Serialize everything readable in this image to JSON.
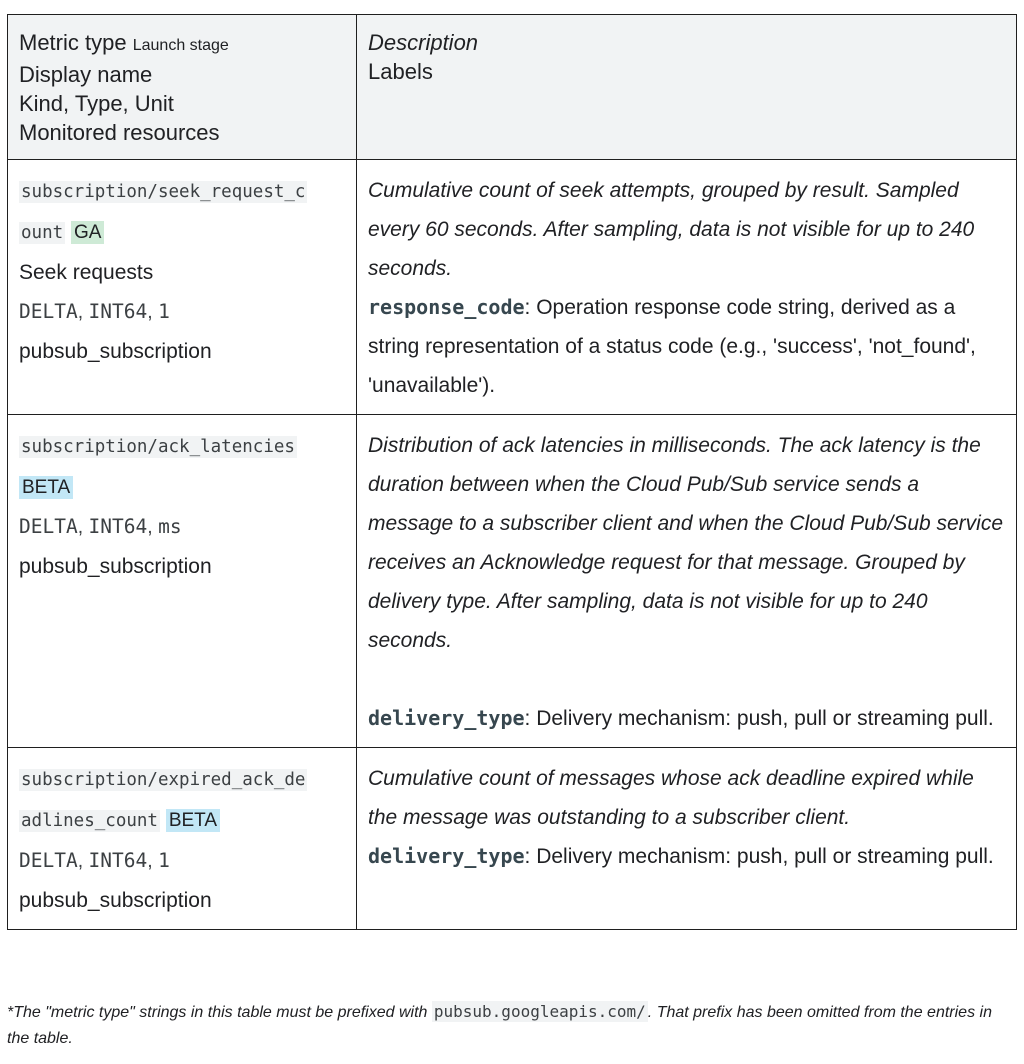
{
  "header": {
    "col1_line1": "Metric type",
    "col1_launch": "Launch stage",
    "col1_line2": "Display name",
    "col1_line3": "Kind, Type, Unit",
    "col1_line4": "Monitored resources",
    "col2_line1": "Description",
    "col2_line2": "Labels"
  },
  "rows": [
    {
      "metric_a": "subscription/seek_request_c",
      "metric_b": "ount",
      "stage": "GA",
      "display_name": "Seek requests",
      "kind": "DELTA",
      "type": "INT64",
      "unit": "1",
      "resource": "pubsub_subscription",
      "description": "Cumulative count of seek attempts, grouped by result. Sampled every 60 seconds. After sampling, data is not visible for up to 240 seconds.",
      "label_name": "response_code",
      "label_desc": ": Operation response code string, derived as a string representation of a status code (e.g., 'success', 'not_found', 'unavailable')."
    },
    {
      "metric_a": "subscription/ack_latencies",
      "stage": "BETA",
      "kind": "DELTA",
      "type": "INT64",
      "unit": "ms",
      "resource": "pubsub_subscription",
      "description": "Distribution of ack latencies in milliseconds. The ack latency is the duration between when the Cloud Pub/Sub service sends a message to a subscriber client and when the Cloud Pub/Sub service receives an Acknowledge request for that message. Grouped by delivery type. After sampling, data is not visible for up to 240 seconds.",
      "label_name": "delivery_type",
      "label_desc": ": Delivery mechanism: push, pull or streaming pull."
    },
    {
      "metric_a": "subscription/expired_ack_de",
      "metric_b": "adlines_count",
      "stage": "BETA",
      "kind": "DELTA",
      "type": "INT64",
      "unit": "1",
      "resource": "pubsub_subscription",
      "description": "Cumulative count of messages whose ack deadline expired while the message was outstanding to a subscriber client.",
      "label_name": "delivery_type",
      "label_desc": ": Delivery mechanism: push, pull or streaming pull."
    }
  ],
  "footnote": {
    "before": "*The \"metric type\" strings in this table must be prefixed with ",
    "code": "pubsub.googleapis.com/",
    "after": ". That prefix has been omitted from the entries in the table."
  }
}
